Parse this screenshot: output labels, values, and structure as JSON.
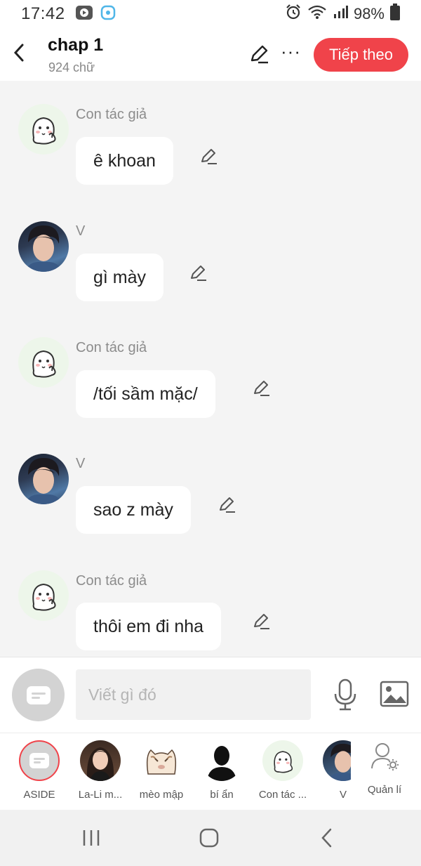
{
  "status_bar": {
    "time": "17:42",
    "battery": "98%"
  },
  "header": {
    "title": "chap 1",
    "subtitle": "924 chữ",
    "next_button": "Tiếp theo"
  },
  "messages": [
    {
      "sender": "Con tác giả",
      "avatar": "ghost-sticker",
      "text": "ê khoan"
    },
    {
      "sender": "V",
      "avatar": "person-photo",
      "text": "gì mày"
    },
    {
      "sender": "Con tác giả",
      "avatar": "ghost-sticker",
      "text": "/tối sầm mặc/"
    },
    {
      "sender": "V",
      "avatar": "person-photo",
      "text": "sao z mày"
    },
    {
      "sender": "Con tác giả",
      "avatar": "ghost-sticker",
      "text": "thôi em đi nha"
    }
  ],
  "composer": {
    "placeholder": "Viết gì đó"
  },
  "characters": [
    {
      "label": "ASIDE",
      "avatar": "aside-icon"
    },
    {
      "label": "La-Li m...",
      "avatar": "person-photo"
    },
    {
      "label": "mèo mập",
      "avatar": "cat-sticker"
    },
    {
      "label": "bí ẩn",
      "avatar": "silhouette"
    },
    {
      "label": "Con tác ...",
      "avatar": "ghost-sticker"
    },
    {
      "label": "V",
      "avatar": "person-photo"
    }
  ],
  "manage_label": "Quản lí",
  "colors": {
    "accent": "#f0434a",
    "background": "#f4f4f4",
    "bubble": "#ffffff",
    "muted_text": "#8c8c8c"
  }
}
